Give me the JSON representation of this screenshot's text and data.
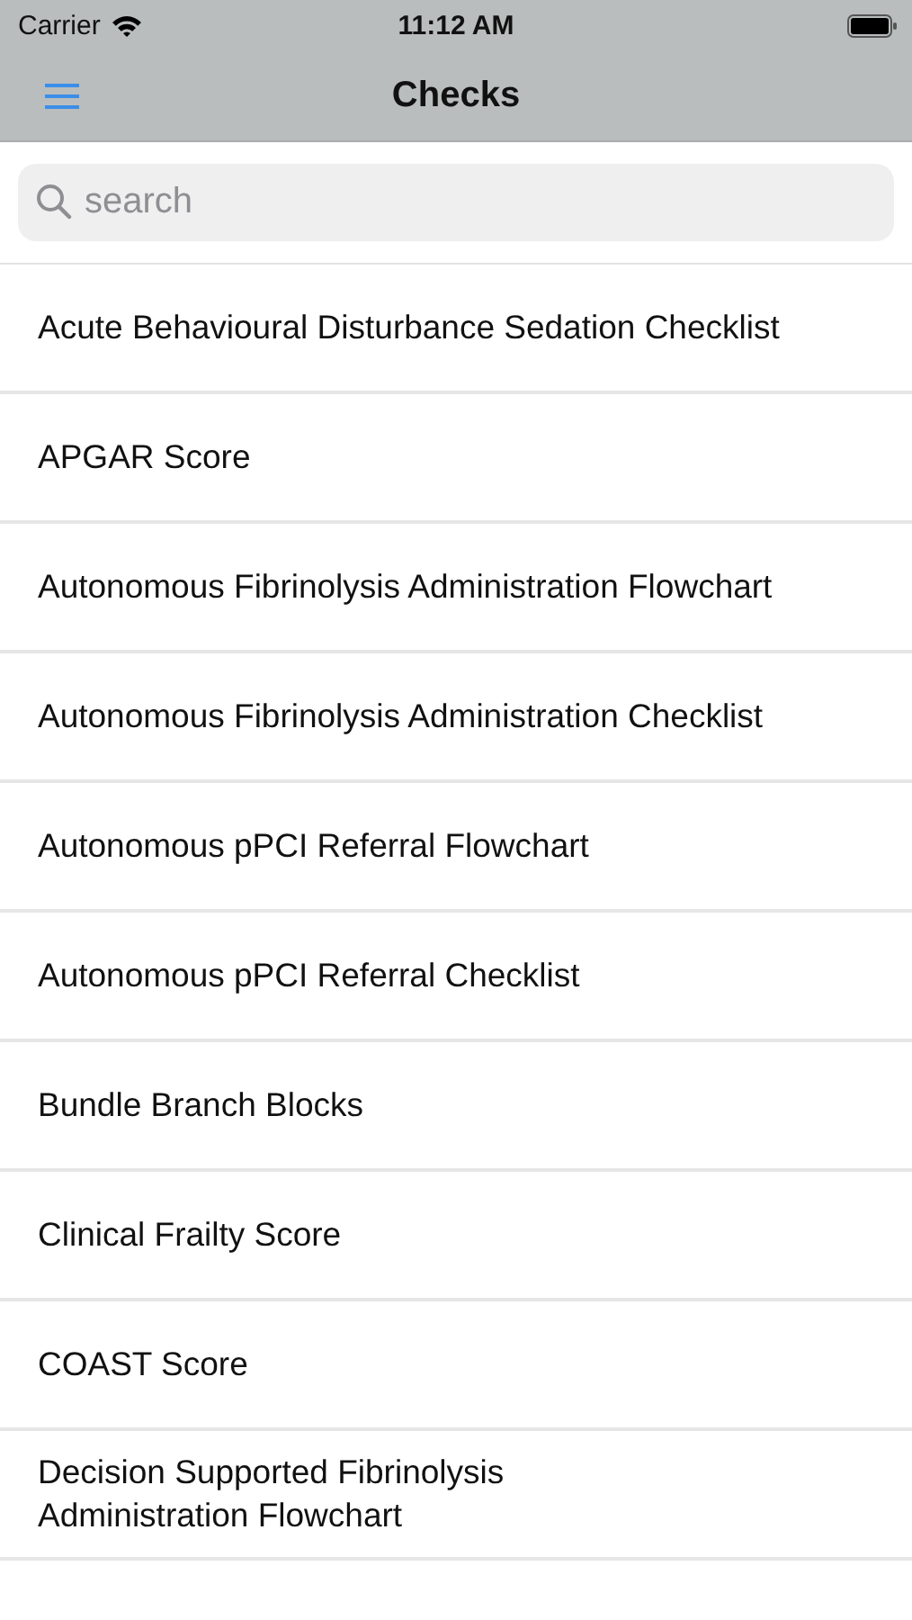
{
  "status_bar": {
    "carrier": "Carrier",
    "time": "11:12 AM"
  },
  "nav": {
    "title": "Checks"
  },
  "search": {
    "placeholder": "search"
  },
  "items": [
    {
      "label": "Acute Behavioural Disturbance Sedation Checklist"
    },
    {
      "label": "APGAR Score"
    },
    {
      "label": "Autonomous Fibrinolysis Administration Flowchart"
    },
    {
      "label": "Autonomous Fibrinolysis Administration Checklist"
    },
    {
      "label": "Autonomous pPCI Referral Flowchart"
    },
    {
      "label": "Autonomous pPCI Referral Checklist"
    },
    {
      "label": "Bundle Branch Blocks"
    },
    {
      "label": "Clinical Frailty Score"
    },
    {
      "label": "COAST Score"
    },
    {
      "label": "Decision Supported Fibrinolysis\nAdministration Flowchart"
    }
  ]
}
